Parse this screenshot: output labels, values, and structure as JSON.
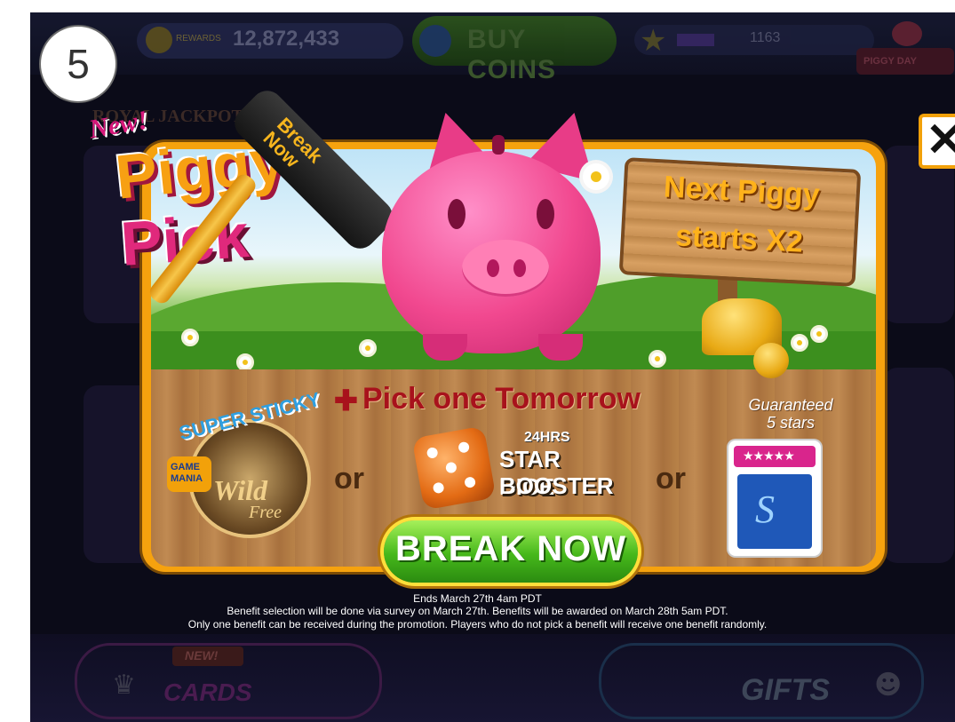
{
  "step_number": "5",
  "hud": {
    "rewards_label": "REWARDS",
    "rewards_value": "12,872,433",
    "buy_coins_label": "BUY COINS",
    "level_value": "1163",
    "piggy_day_label": "PIGGY DAY",
    "royal_jackpot": "ROYAL JACKPOT"
  },
  "popup": {
    "new_tag": "New!",
    "logo_line1": "Piggy",
    "logo_line2": "Pick",
    "hammer_text": "Break\nNow",
    "sign_line1": "Next Piggy",
    "sign_line2": "starts X2",
    "pick_heading": "Pick one Tomorrow",
    "option1": {
      "arc_text": "SUPER STICKY",
      "badge_text": "GAME\nMANIA",
      "title1": "Wild",
      "title2": "Free"
    },
    "or_text": "or",
    "option2": {
      "hours": "24HRS",
      "line1": "STAR DICE",
      "line2": "BOOSTER"
    },
    "option3": {
      "guarantee_line1": "Guaranteed",
      "guarantee_line2": "5 stars",
      "stars": "★★★★★",
      "card_letter": "S"
    },
    "cta_label": "BREAK NOW"
  },
  "fine_print": {
    "line1": "Ends March 27th 4am PDT",
    "line2": "Benefit selection will be done via survey on March 27th. Benefits will be awarded on March 28th 5am PDT.",
    "line3": "Only one benefit can be received during the promotion. Players who do not pick a benefit will receive one benefit randomly."
  },
  "bottom_nav": {
    "new_badge": "NEW!",
    "cards_label": "CARDS",
    "gifts_label": "GIFTS"
  },
  "colors": {
    "popup_border": "#f6a20e",
    "cta_green": "#46b81b",
    "heading_red": "#a8121c",
    "pig_pink": "#f1488f"
  }
}
